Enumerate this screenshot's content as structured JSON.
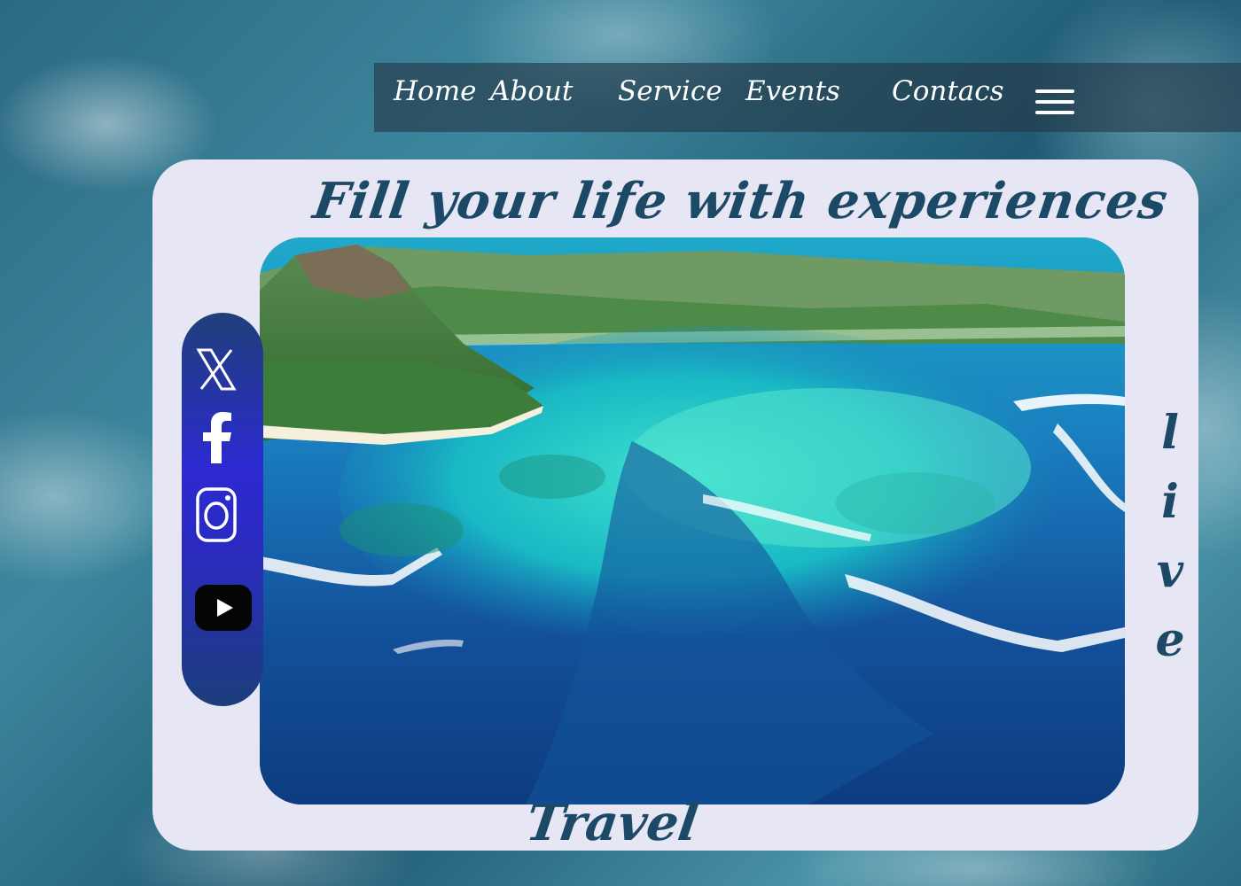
{
  "nav": {
    "items": [
      {
        "label": "Home"
      },
      {
        "label": "About"
      },
      {
        "label": "Service"
      },
      {
        "label": "Events"
      },
      {
        "label": "Contacs"
      }
    ],
    "menu_icon": "hamburger-menu-icon"
  },
  "hero": {
    "headline": "Fill your life with experiences",
    "vertical_word": [
      "l",
      "i",
      "v",
      "e"
    ],
    "footer_word": "Travel",
    "image": "aerial-island-lagoon-photo"
  },
  "social": {
    "icons": [
      "x-icon",
      "facebook-icon",
      "instagram-icon",
      "youtube-icon"
    ]
  },
  "colors": {
    "accent_text": "#1c4a66",
    "card_bg": "#e7e6f5",
    "sidebar_blue": "#2c2ad1",
    "nav_bg": "rgba(35,55,70,0.62)"
  }
}
